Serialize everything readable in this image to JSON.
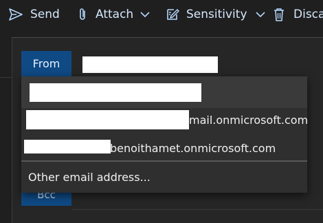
{
  "toolbar": {
    "send_label": "Send",
    "attach_label": "Attach",
    "sensitivity_label": "Sensitivity",
    "discard_label": "Disca"
  },
  "header": {
    "from_label": "From",
    "bcc_label": "Bcc"
  },
  "from_dropdown": {
    "options": [
      {
        "visible_suffix": "mail.onmicrosoft.com"
      },
      {
        "visible_suffix": "benoithamet.onmicrosoft.com"
      }
    ],
    "other_label": "Other email address..."
  },
  "colors": {
    "background": "#1f1f1f",
    "accent_button": "#0f4a85",
    "icon_blue": "#b4d7ff",
    "dropdown_bg": "#2f2f2f"
  }
}
